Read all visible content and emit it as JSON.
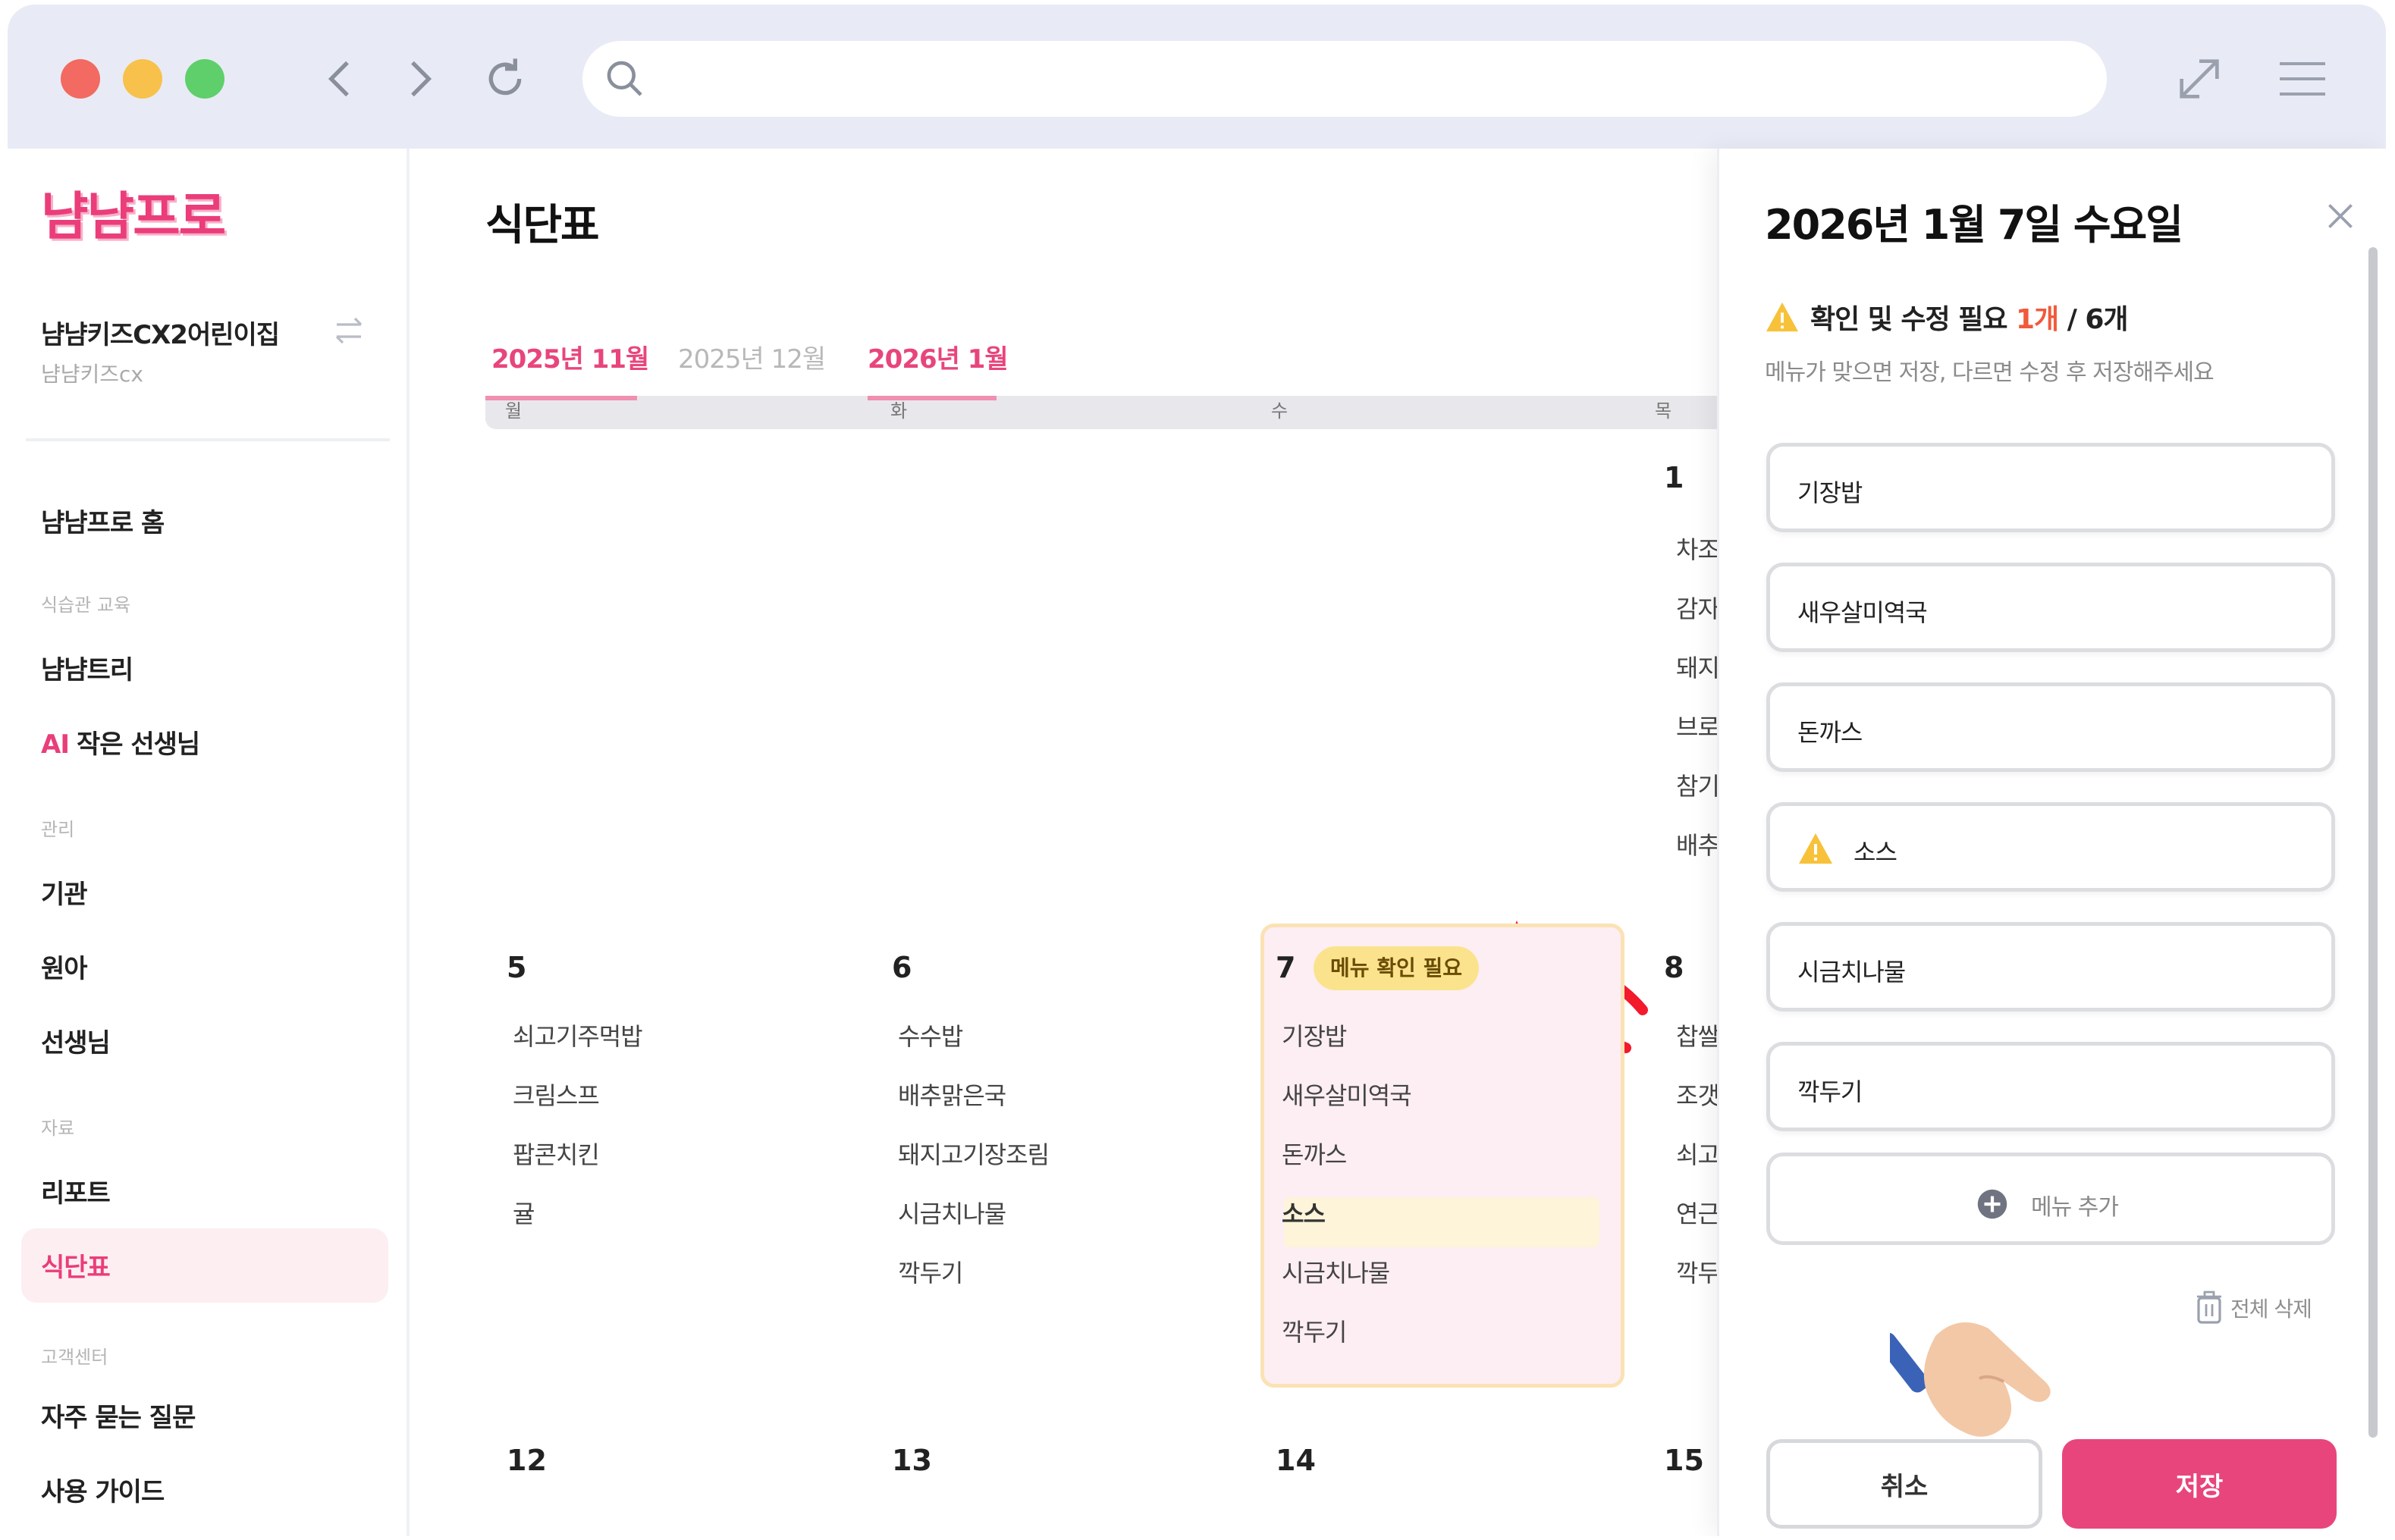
{
  "sidebar": {
    "logo": "냠냠프로",
    "org_name": "냠냠키즈CX2어린이집",
    "org_sub": "냠냠키즈cx",
    "home": "냠냠프로 홈",
    "section_edu": "식습관 교육",
    "nyam_tree": "냠냠트리",
    "ai_prefix": "AI",
    "ai_teacher": "작은 선생님",
    "section_manage": "관리",
    "institution": "기관",
    "children": "원아",
    "teachers": "선생님",
    "section_data": "자료",
    "report": "리포트",
    "meal_plan": "식단표",
    "section_support": "고객센터",
    "faq": "자주 묻는 질문",
    "guide": "사용 가이드"
  },
  "main": {
    "title": "식단표",
    "months": [
      "2025년 11월",
      "2025년 12월",
      "2026년 1월"
    ],
    "weekday_partial": [
      "월",
      "화",
      "수",
      "목"
    ],
    "days": {
      "d1": {
        "num": "1",
        "meals": [
          "차조",
          "감자",
          "돼지",
          "브로",
          "참기",
          "배추"
        ]
      },
      "d5": {
        "num": "5",
        "meals": [
          "쇠고기주먹밥",
          "크림스프",
          "팝콘치킨",
          "귤"
        ]
      },
      "d6": {
        "num": "6",
        "meals": [
          "수수밥",
          "배추맑은국",
          "돼지고기장조림",
          "시금치나물",
          "깍두기"
        ]
      },
      "d7": {
        "num": "7",
        "badge": "메뉴 확인 필요",
        "meals": [
          "기장밥",
          "새우살미역국",
          "돈까스",
          "소스",
          "시금치나물",
          "깍두기"
        ]
      },
      "d8": {
        "num": "8",
        "meals": [
          "찹쌀",
          "조갯",
          "쇠고",
          "연근",
          "깍두"
        ]
      },
      "d12": {
        "num": "12"
      },
      "d13": {
        "num": "13"
      },
      "d14": {
        "num": "14"
      },
      "d15": {
        "num": "15"
      }
    }
  },
  "panel": {
    "title": "2026년 1월 7일 수요일",
    "warn_text": "확인 및 수정 필요",
    "warn_count": "1개",
    "warn_total": " / 6개",
    "warn_sub": "메뉴가 맞으면 저장, 다르면 수정 후 저장해주세요",
    "items": [
      "기장밥",
      "새우살미역국",
      "돈까스",
      "소스",
      "시금치나물",
      "깍두기"
    ],
    "warned_index": 3,
    "add_menu": "메뉴 추가",
    "delete_all": "전체 삭제",
    "cancel": "취소",
    "save": "저장"
  },
  "colors": {
    "accent": "#e8457c",
    "chrome": "#e8ebf5",
    "badge": "#fbe38d",
    "today_bg": "#fdeef3"
  },
  "icons": [
    "back-icon",
    "forward-icon",
    "reload-icon",
    "search-icon",
    "expand-icon",
    "menu-icon",
    "swap-icon",
    "close-icon",
    "warning-icon",
    "plus-icon",
    "trash-icon",
    "pointing-hand-icon",
    "sparkle-icon"
  ]
}
